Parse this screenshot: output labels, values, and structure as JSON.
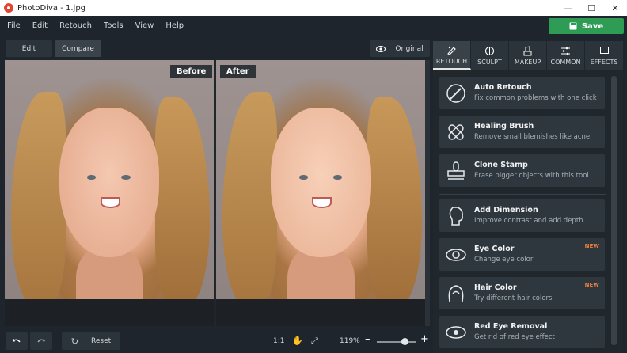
{
  "window": {
    "title": "PhotoDiva - 1.jpg"
  },
  "menu": [
    "File",
    "Edit",
    "Retouch",
    "Tools",
    "View",
    "Help"
  ],
  "save_label": "Save",
  "toolbar": {
    "edit": "Edit",
    "compare": "Compare",
    "original": "Original"
  },
  "viewer": {
    "before": "Before",
    "after": "After"
  },
  "statusbar": {
    "reset": "Reset",
    "ratio": "1:1",
    "zoom": "119%",
    "zoom_level": 0.7
  },
  "tabs": [
    {
      "label": "RETOUCH",
      "icon": "retouch-icon",
      "active": true
    },
    {
      "label": "SCULPT",
      "icon": "sculpt-icon"
    },
    {
      "label": "MAKEUP",
      "icon": "makeup-icon"
    },
    {
      "label": "COMMON",
      "icon": "sliders-icon"
    },
    {
      "label": "EFFECTS",
      "icon": "effects-icon"
    }
  ],
  "tools": [
    {
      "name": "Auto Retouch",
      "desc": "Fix common problems with one click",
      "icon": "auto-retouch-icon",
      "badge": ""
    },
    {
      "name": "Healing Brush",
      "desc": "Remove small blemishes like acne",
      "icon": "bandage-icon",
      "badge": ""
    },
    {
      "name": "Clone Stamp",
      "desc": "Erase bigger objects with this tool",
      "icon": "stamp-icon",
      "badge": ""
    },
    {
      "name": "Add Dimension",
      "desc": "Improve contrast and add depth",
      "icon": "dimension-icon",
      "badge": ""
    },
    {
      "name": "Eye Color",
      "desc": "Change eye color",
      "icon": "eye-color-icon",
      "badge": "NEW"
    },
    {
      "name": "Hair Color",
      "desc": "Try different hair colors",
      "icon": "hair-icon",
      "badge": "NEW"
    },
    {
      "name": "Red Eye Removal",
      "desc": "Get rid of red eye effect",
      "icon": "red-eye-icon",
      "badge": ""
    }
  ]
}
